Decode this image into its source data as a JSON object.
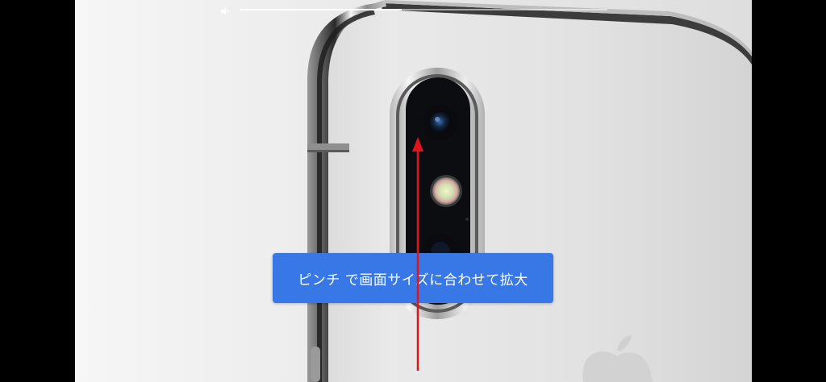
{
  "player": {
    "volume_icon": "speaker-icon",
    "progress_fraction": 0.44
  },
  "overlay": {
    "pinch_hint": "ピンチ で画面サイズに合わせて拡大",
    "arrow_icon": "arrow-up-icon"
  },
  "colors": {
    "banner": "#3777e6",
    "arrow": "#e1141b"
  }
}
